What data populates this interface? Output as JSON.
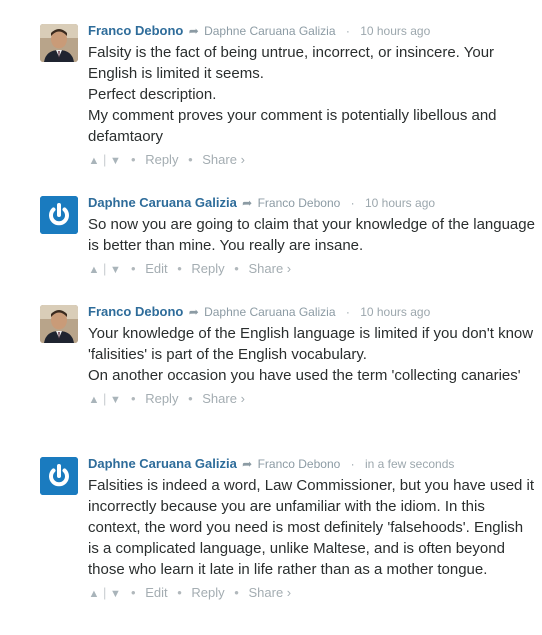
{
  "comments": [
    {
      "author": "Franco Debono",
      "reply_to": "Daphne Caruana Galizia",
      "time": "10 hours ago",
      "avatar": "photo",
      "paragraphs": [
        "Falsity is the fact of being untrue, incorrect, or insincere. Your English is limited it seems.",
        "Perfect description.",
        "My comment proves your comment is potentially libellous and defamtaory"
      ],
      "actions": {
        "reply": "Reply",
        "share": "Share ›"
      }
    },
    {
      "author": "Daphne Caruana Galizia",
      "reply_to": "Franco Debono",
      "time": "10 hours ago",
      "avatar": "logo",
      "paragraphs": [
        "So now you are going to claim that your knowledge of the language is better than mine. You really are insane."
      ],
      "actions": {
        "edit": "Edit",
        "reply": "Reply",
        "share": "Share ›"
      }
    },
    {
      "author": "Franco Debono",
      "reply_to": "Daphne Caruana Galizia",
      "time": "10 hours ago",
      "avatar": "photo",
      "paragraphs": [
        "Your knowledge of the English language is limited if you don't know 'falisities' is part of the English vocabulary.",
        "On another occasion you have used the term 'collecting canaries'"
      ],
      "actions": {
        "reply": "Reply",
        "share": "Share ›"
      }
    },
    {
      "author": "Daphne Caruana Galizia",
      "reply_to": "Franco Debono",
      "time": "in a few seconds",
      "avatar": "logo",
      "paragraphs": [
        "Falsities is indeed a word, Law Commissioner, but you have used it incorrectly because you are unfamiliar with the idiom. In this context, the word you need is most definitely 'falsehoods'. English is a complicated language, unlike Maltese, and is often beyond those who learn it late in life rather than as a mother tongue."
      ],
      "actions": {
        "edit": "Edit",
        "reply": "Reply",
        "share": "Share ›"
      }
    }
  ],
  "colors": {
    "author": "#2e6c9a",
    "logo_blue": "#1a7bbf",
    "muted": "#9ca7ad"
  }
}
